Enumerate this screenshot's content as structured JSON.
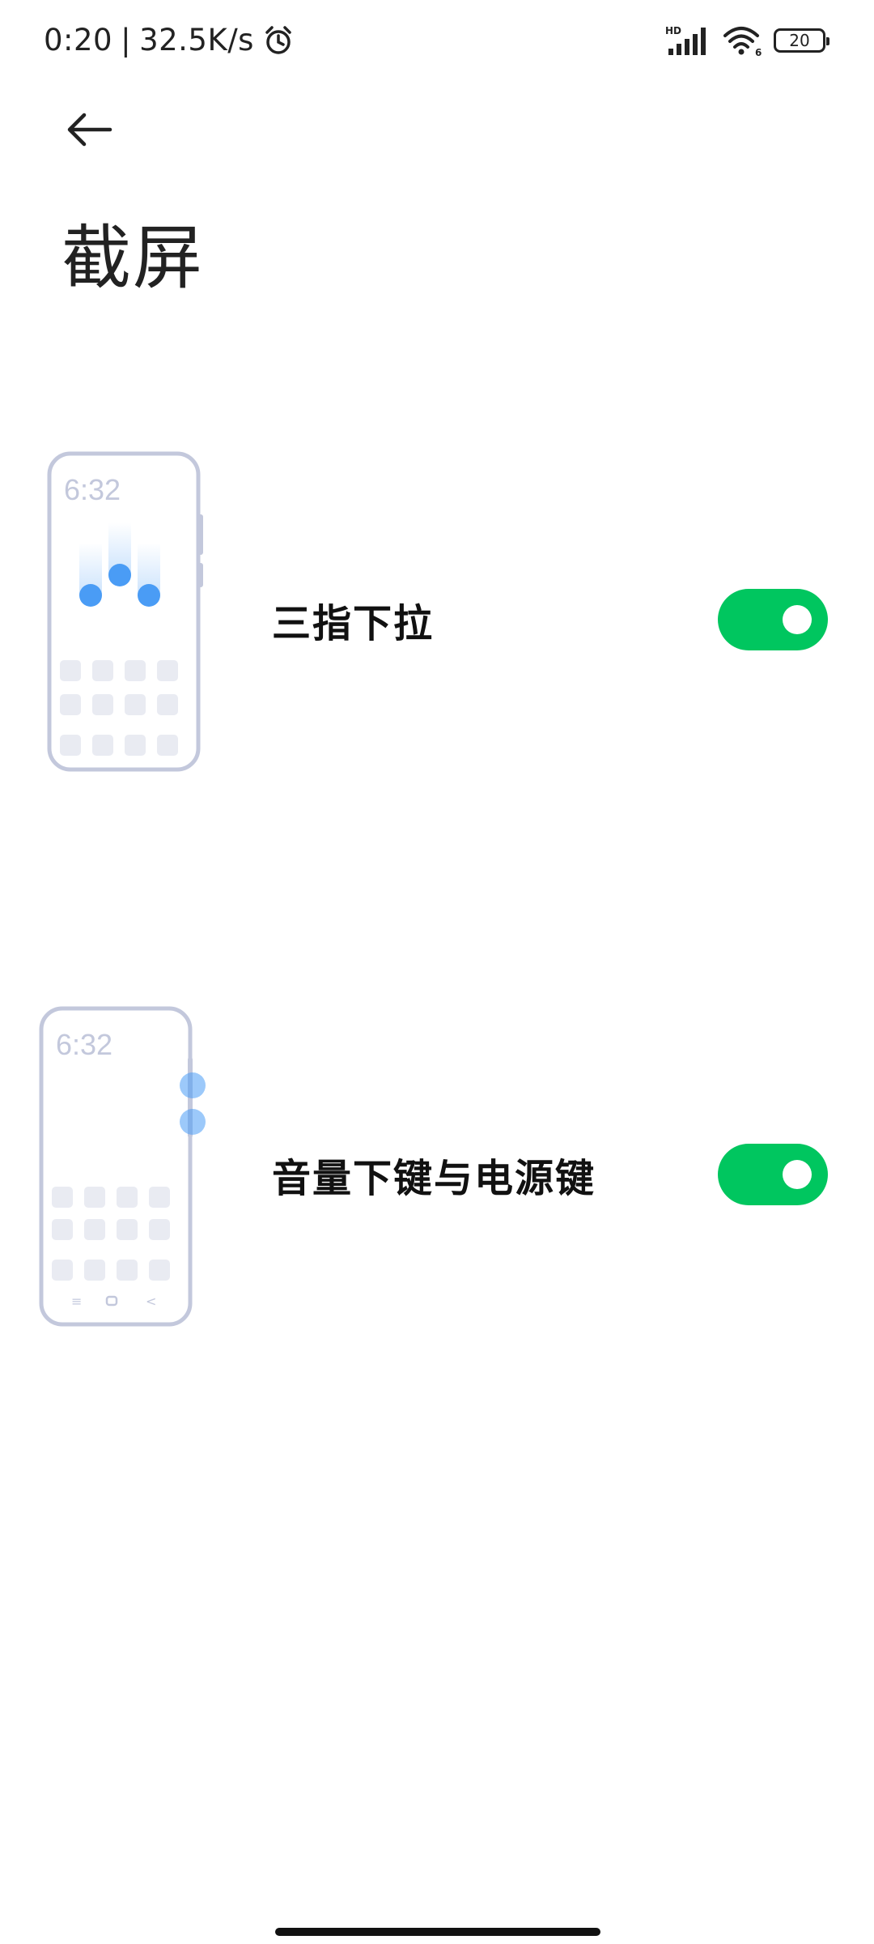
{
  "status_bar": {
    "time": "0:20",
    "separator": "|",
    "net_speed": "32.5K/s",
    "alarm_icon": "alarm-clock-icon",
    "hd_label": "HD",
    "signal_icon": "cellular-signal-icon",
    "wifi_icon": "wifi-icon",
    "wifi_badge": "6",
    "battery_level": "20"
  },
  "header": {
    "back_icon": "arrow-left-icon",
    "title": "截屏"
  },
  "options": [
    {
      "label": "三指下拉",
      "enabled": true,
      "illustration": {
        "clock": "6:32"
      }
    },
    {
      "label": "音量下键与电源键",
      "enabled": true,
      "illustration": {
        "clock": "6:32",
        "nav_menu": "≡",
        "nav_back": "<"
      }
    }
  ],
  "colors": {
    "toggle_on": "#00c65f",
    "illustration_stroke": "#c3c8dc",
    "illustration_accent": "#4a9cf5",
    "illustration_tile": "#e9ebf2"
  }
}
